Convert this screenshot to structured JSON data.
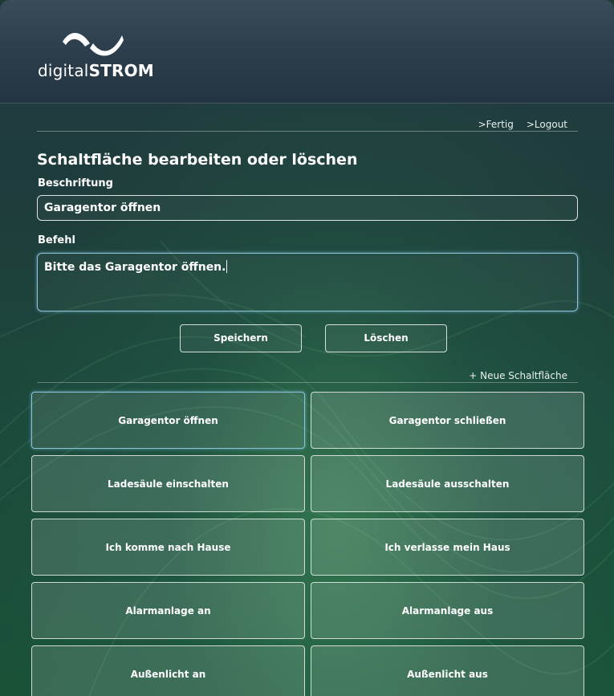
{
  "brand": {
    "name_bold_part": "digital",
    "name_strong_part": "STROM"
  },
  "nav": {
    "done": ">Fertig",
    "logout": ">Logout"
  },
  "page": {
    "title": "Schaltfläche bearbeiten oder löschen"
  },
  "form": {
    "caption_label": "Beschriftung",
    "caption_value": "Garagentor öffnen",
    "command_label": "Befehl",
    "command_value": "Bitte das Garagentor öffnen."
  },
  "actions": {
    "save": "Speichern",
    "delete": "Löschen",
    "new_button": "+ Neue Schaltfläche"
  },
  "tiles": [
    {
      "label": "Garagentor öffnen",
      "selected": true
    },
    {
      "label": "Garagentor schließen"
    },
    {
      "label": "Ladesäule einschalten"
    },
    {
      "label": "Ladesäule ausschalten"
    },
    {
      "label": "Ich komme nach Hause"
    },
    {
      "label": "Ich verlasse mein Haus"
    },
    {
      "label": "Alarmanlage an"
    },
    {
      "label": "Alarmanlage aus"
    },
    {
      "label": "Außenlicht an"
    },
    {
      "label": "Außenlicht aus"
    }
  ]
}
